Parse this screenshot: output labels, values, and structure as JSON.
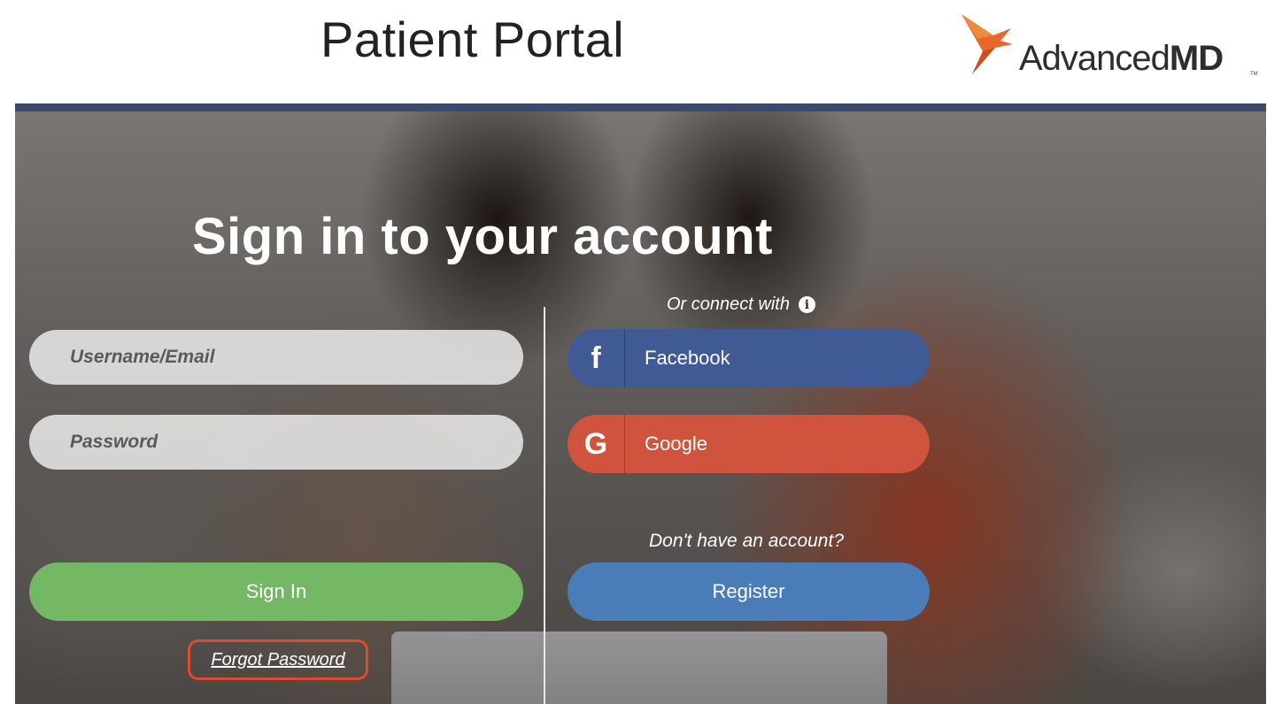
{
  "header": {
    "title": "Patient Portal",
    "logo": {
      "text_light": "Advanced",
      "text_bold": "MD",
      "tm": "TM"
    }
  },
  "login": {
    "heading": "Sign in to your account",
    "username_placeholder": "Username/Email",
    "password_placeholder": "Password",
    "signin_label": "Sign In",
    "forgot_label": "Forgot Password"
  },
  "connect": {
    "label": "Or connect with",
    "facebook_label": "Facebook",
    "google_label": "Google"
  },
  "register": {
    "prompt": "Don't have an account?",
    "button_label": "Register"
  },
  "colors": {
    "facebook": "#3f5a94",
    "google": "#d0533e",
    "signin": "#74b866",
    "register": "#4a7db8",
    "logo_orange": "#e8672a",
    "highlight": "#e04a2e"
  }
}
